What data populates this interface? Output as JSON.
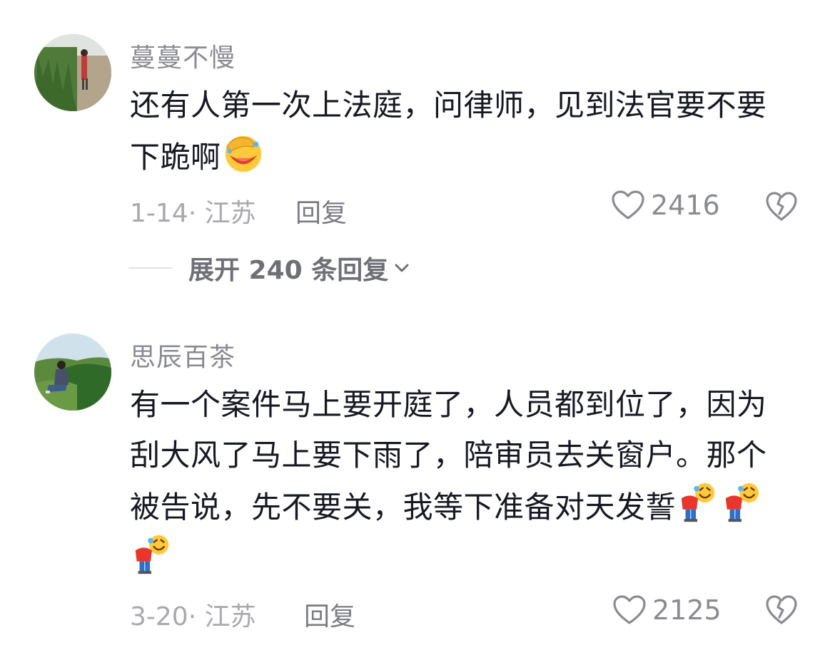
{
  "comments": [
    {
      "username": "蔓蔓不慢",
      "text_line1": "还有人第一次上法庭，问律师，见到法官要不要",
      "text_line2": "下跪啊",
      "emoji": "facepalm-laugh-emoji",
      "date_location": "1-14· 江苏",
      "reply_label": "回复",
      "likes": "2416",
      "expand_label": "展开 240 条回复"
    },
    {
      "username": "思辰百茶",
      "text_line1": "有一个案件马上要开庭了，人员都到位了，因为",
      "text_line2": "刮大风了马上要下雨了，陪审员去关窗户。那个",
      "text_line3": "被告说，先不要关，我等下准备对天发誓",
      "emoji": "bowing-laugh-emoji",
      "emoji_count": 3,
      "date_location": "3-20· 江苏",
      "reply_label": "回复",
      "likes": "2125"
    }
  ],
  "icons": {
    "like": "heart-outline-icon",
    "dislike": "broken-heart-icon",
    "expand": "chevron-down-icon"
  },
  "colors": {
    "username": "#8a8b91",
    "meta": "#a8a9ad",
    "text": "#161823"
  }
}
